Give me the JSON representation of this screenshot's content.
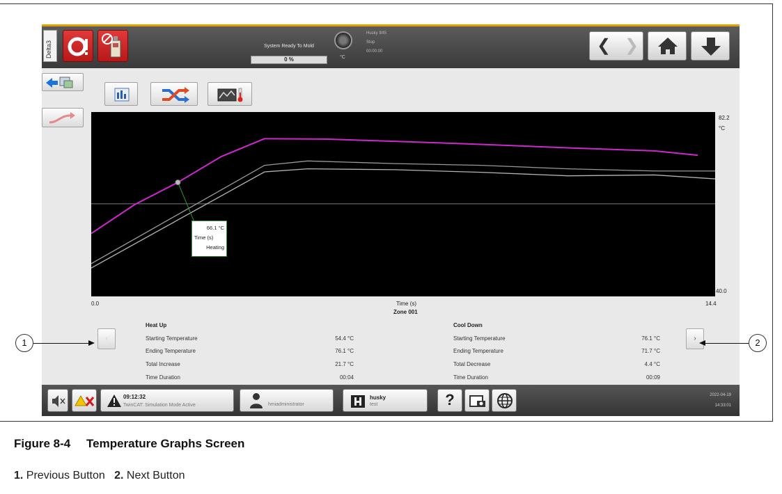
{
  "header": {
    "side_tab_label": "Delta3",
    "system_status": "System Ready To Mold",
    "progress_text": "0 %",
    "progress": 0,
    "gauge_unit": "°C",
    "husky_lines": [
      "Husky IMS",
      "Stop",
      "00:00:00"
    ]
  },
  "chart_data": {
    "type": "line",
    "title": "Zone 001",
    "xlabel": "Time (s)",
    "xlim": [
      0.0,
      14.4
    ],
    "ylim": [
      40.0,
      82.2
    ],
    "y_unit": "°C",
    "x_tick_min": "0.0",
    "x_tick_max": "14.4",
    "y_tick_max": "82.2",
    "y_tick_min": "40.0",
    "series": [
      {
        "color": "#d026d0",
        "x": [
          0.0,
          1.0,
          2.0,
          3.0,
          4.0,
          5.4,
          7.0,
          9.0,
          11.0,
          13.0,
          14.0
        ],
        "y": [
          54.4,
          61.0,
          66.1,
          72.0,
          76.1,
          76.0,
          75.5,
          74.8,
          74.0,
          73.3,
          72.3
        ]
      },
      {
        "color": "#9a9a9a",
        "x": [
          0.0,
          4.0,
          5.0,
          7.0,
          9.0,
          11.0,
          13.0,
          14.4
        ],
        "y": [
          47.5,
          70.0,
          71.0,
          70.4,
          70.0,
          69.2,
          68.7,
          68.7
        ]
      },
      {
        "color": "#b5b5b5",
        "x": [
          0.0,
          4.0,
          5.0,
          7.0,
          9.0,
          11.0,
          13.0,
          14.4
        ],
        "y": [
          46.5,
          68.5,
          69.2,
          69.0,
          68.4,
          67.6,
          67.8,
          66.9
        ]
      }
    ],
    "reference_y": 61.2,
    "tooltip": {
      "temperature": "66.1 °C",
      "label": "Time (s)",
      "state": "Heating"
    }
  },
  "heat_up": {
    "title": "Heat Up",
    "rows": [
      {
        "label": "Starting Temperature",
        "value": "54.4 °C"
      },
      {
        "label": "Ending Temperature",
        "value": "76.1 °C"
      },
      {
        "label": "Total Increase",
        "value": "21.7 °C"
      },
      {
        "label": "Time Duration",
        "value": "00:04"
      }
    ]
  },
  "cool_down": {
    "title": "Cool Down",
    "rows": [
      {
        "label": "Starting Temperature",
        "value": "76.1 °C"
      },
      {
        "label": "Ending Temperature",
        "value": "71.7 °C"
      },
      {
        "label": "Total Decrease",
        "value": "4.4 °C"
      },
      {
        "label": "Time Duration",
        "value": "00:09"
      }
    ]
  },
  "pager": {
    "prev": "‹",
    "next": "›"
  },
  "statusbar": {
    "alarm_time": "09:12:32",
    "alarm_text": "TwinCAT: Simulation Mode Active",
    "user": "hmiadministrator",
    "mold_name": "husky",
    "mold_sub": "test",
    "help": "?",
    "date": "2022-04-19",
    "time": "14:33:01"
  },
  "callouts": {
    "one": "1",
    "two": "2"
  },
  "figure": {
    "number": "Figure 8-4",
    "title": "Temperature Graphs Screen",
    "legend": [
      {
        "num": "1.",
        "text": "Previous Button"
      },
      {
        "num": "2.",
        "text": "Next Button"
      }
    ]
  }
}
